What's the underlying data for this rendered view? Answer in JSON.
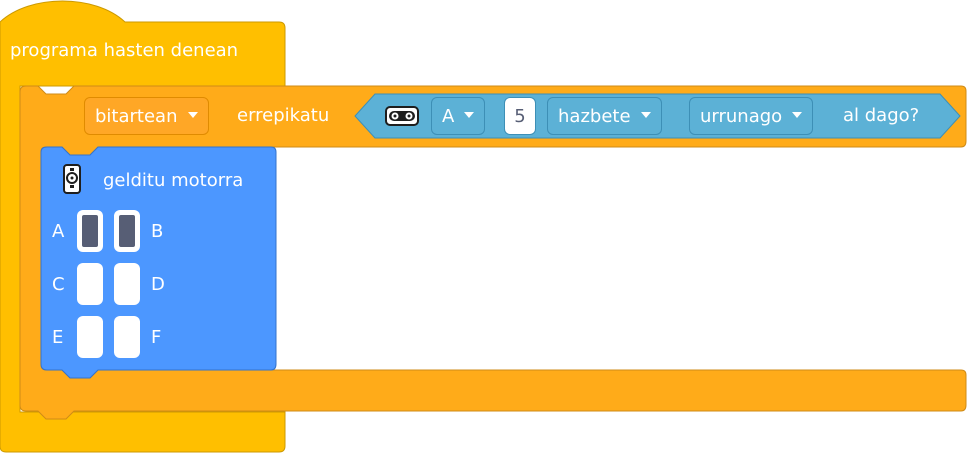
{
  "colors": {
    "events": "#ffbf00",
    "events_border": "#cc9900",
    "control": "#ffab19",
    "control_border": "#cf8b17",
    "sensing": "#5cb1d6",
    "motor": "#4c97ff",
    "motor_border": "#3373cc"
  },
  "hat_block": {
    "label": "programa hasten denean"
  },
  "repeat_block": {
    "mode_label": "bitartean",
    "keyword_label": "errepikatu",
    "condition": {
      "sensor_icon": "distance-sensor-icon",
      "port_label": "A",
      "value": "5",
      "unit_label": "hazbete",
      "comparison_label": "urrunago",
      "suffix_label": "al dago?"
    }
  },
  "motor_block": {
    "icon": "motor-icon",
    "label": "gelditu motorra",
    "ports": [
      {
        "label": "A",
        "selected": true
      },
      {
        "label": "B",
        "selected": true
      },
      {
        "label": "C",
        "selected": false
      },
      {
        "label": "D",
        "selected": false
      },
      {
        "label": "E",
        "selected": false
      },
      {
        "label": "F",
        "selected": false
      }
    ]
  }
}
